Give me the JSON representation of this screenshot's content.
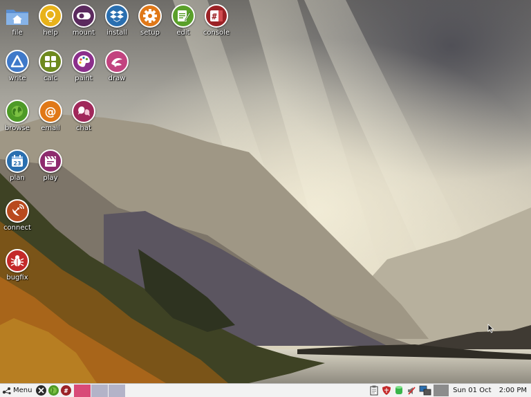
{
  "desktop": {
    "icons": [
      {
        "id": "file",
        "label": "file"
      },
      {
        "id": "help",
        "label": "help"
      },
      {
        "id": "mount",
        "label": "mount"
      },
      {
        "id": "install",
        "label": "install"
      },
      {
        "id": "setup",
        "label": "setup"
      },
      {
        "id": "edit",
        "label": "edit"
      },
      {
        "id": "console",
        "label": "console"
      },
      {
        "id": "write",
        "label": "write"
      },
      {
        "id": "calc",
        "label": "calc"
      },
      {
        "id": "paint",
        "label": "paint"
      },
      {
        "id": "draw",
        "label": "draw"
      },
      {
        "id": "browse",
        "label": "browse"
      },
      {
        "id": "email",
        "label": "email"
      },
      {
        "id": "chat",
        "label": "chat"
      },
      {
        "id": "plan",
        "label": "plan",
        "badge": "23"
      },
      {
        "id": "play",
        "label": "play"
      },
      {
        "id": "connect",
        "label": "connect"
      },
      {
        "id": "bugfix",
        "label": "bugfix"
      }
    ],
    "console_glyph": "#",
    "email_glyph": "@"
  },
  "taskbar": {
    "menu_label": "Menu",
    "quicklaunch_console_glyph": "#",
    "clock": {
      "date": "Sun 01 Oct",
      "time": "2:00 PM"
    }
  },
  "colors": {
    "help": "#e8b21a",
    "mount": "#5b2a5e",
    "install": "#2a6fb0",
    "setup": "#e07818",
    "edit": "#5aa02a",
    "console": "#9b2226",
    "write": "#3f79c9",
    "calc": "#6e8a1e",
    "paint": "#8b2f8b",
    "draw": "#c2437f",
    "browse": "#4e9a27",
    "email": "#e07818",
    "chat": "#a0285a",
    "plan": "#2a6fb0",
    "play": "#8e2b6e",
    "connect": "#b94a1e",
    "bugfix": "#c42a2a",
    "taskbar_pink": "#d94a78",
    "taskbar_slot": "#b3b3c8",
    "tray_gray": "#8c8c8c"
  }
}
